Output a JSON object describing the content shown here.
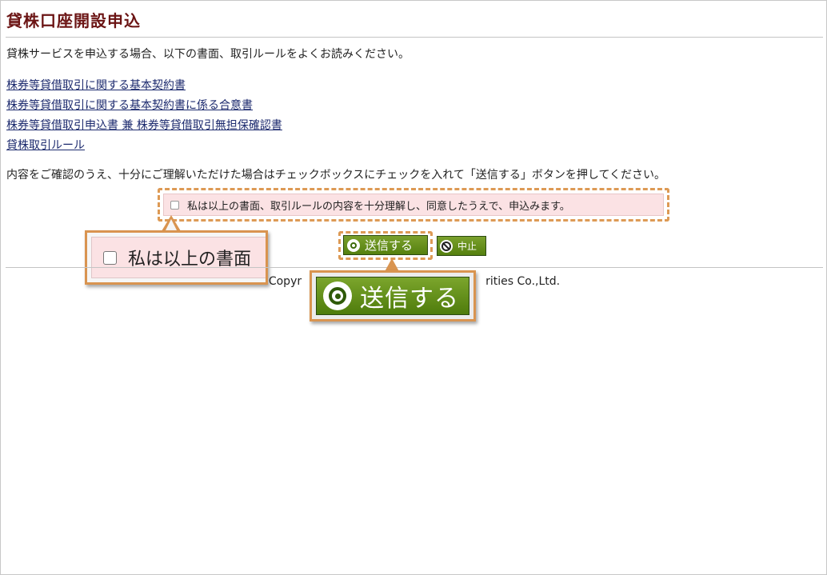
{
  "page": {
    "title": "貸株口座開設申込",
    "intro": "貸株サービスを申込する場合、以下の書面、取引ルールをよくお読みください。",
    "confirm_text": "内容をご確認のうえ、十分にご理解いただけた場合はチェックボックスにチェックを入れて「送信する」ボタンを押してください。"
  },
  "links": [
    "株券等貸借取引に関する基本契約書",
    "株券等貸借取引に関する基本契約書に係る合意書",
    "株券等貸借取引申込書 兼 株券等貸借取引無担保確認書",
    "貸株取引ルール"
  ],
  "agreement": {
    "label": "私は以上の書面、取引ルールの内容を十分理解し、同意したうえで、申込みます。",
    "checked": false,
    "callout_label": "私は以上の書面"
  },
  "buttons": {
    "send_label": "送信する",
    "cancel_label": "中止",
    "send_icon": "target-circle-icon",
    "cancel_icon": "no-entry-icon"
  },
  "footer": {
    "copyright_left": "Copyr",
    "copyright_right": "rities Co.,Ltd."
  },
  "colors": {
    "title": "#6b1414",
    "button_green": "#5e8a18",
    "highlight_orange": "#d99450",
    "agree_bg": "#fbe2e4"
  }
}
